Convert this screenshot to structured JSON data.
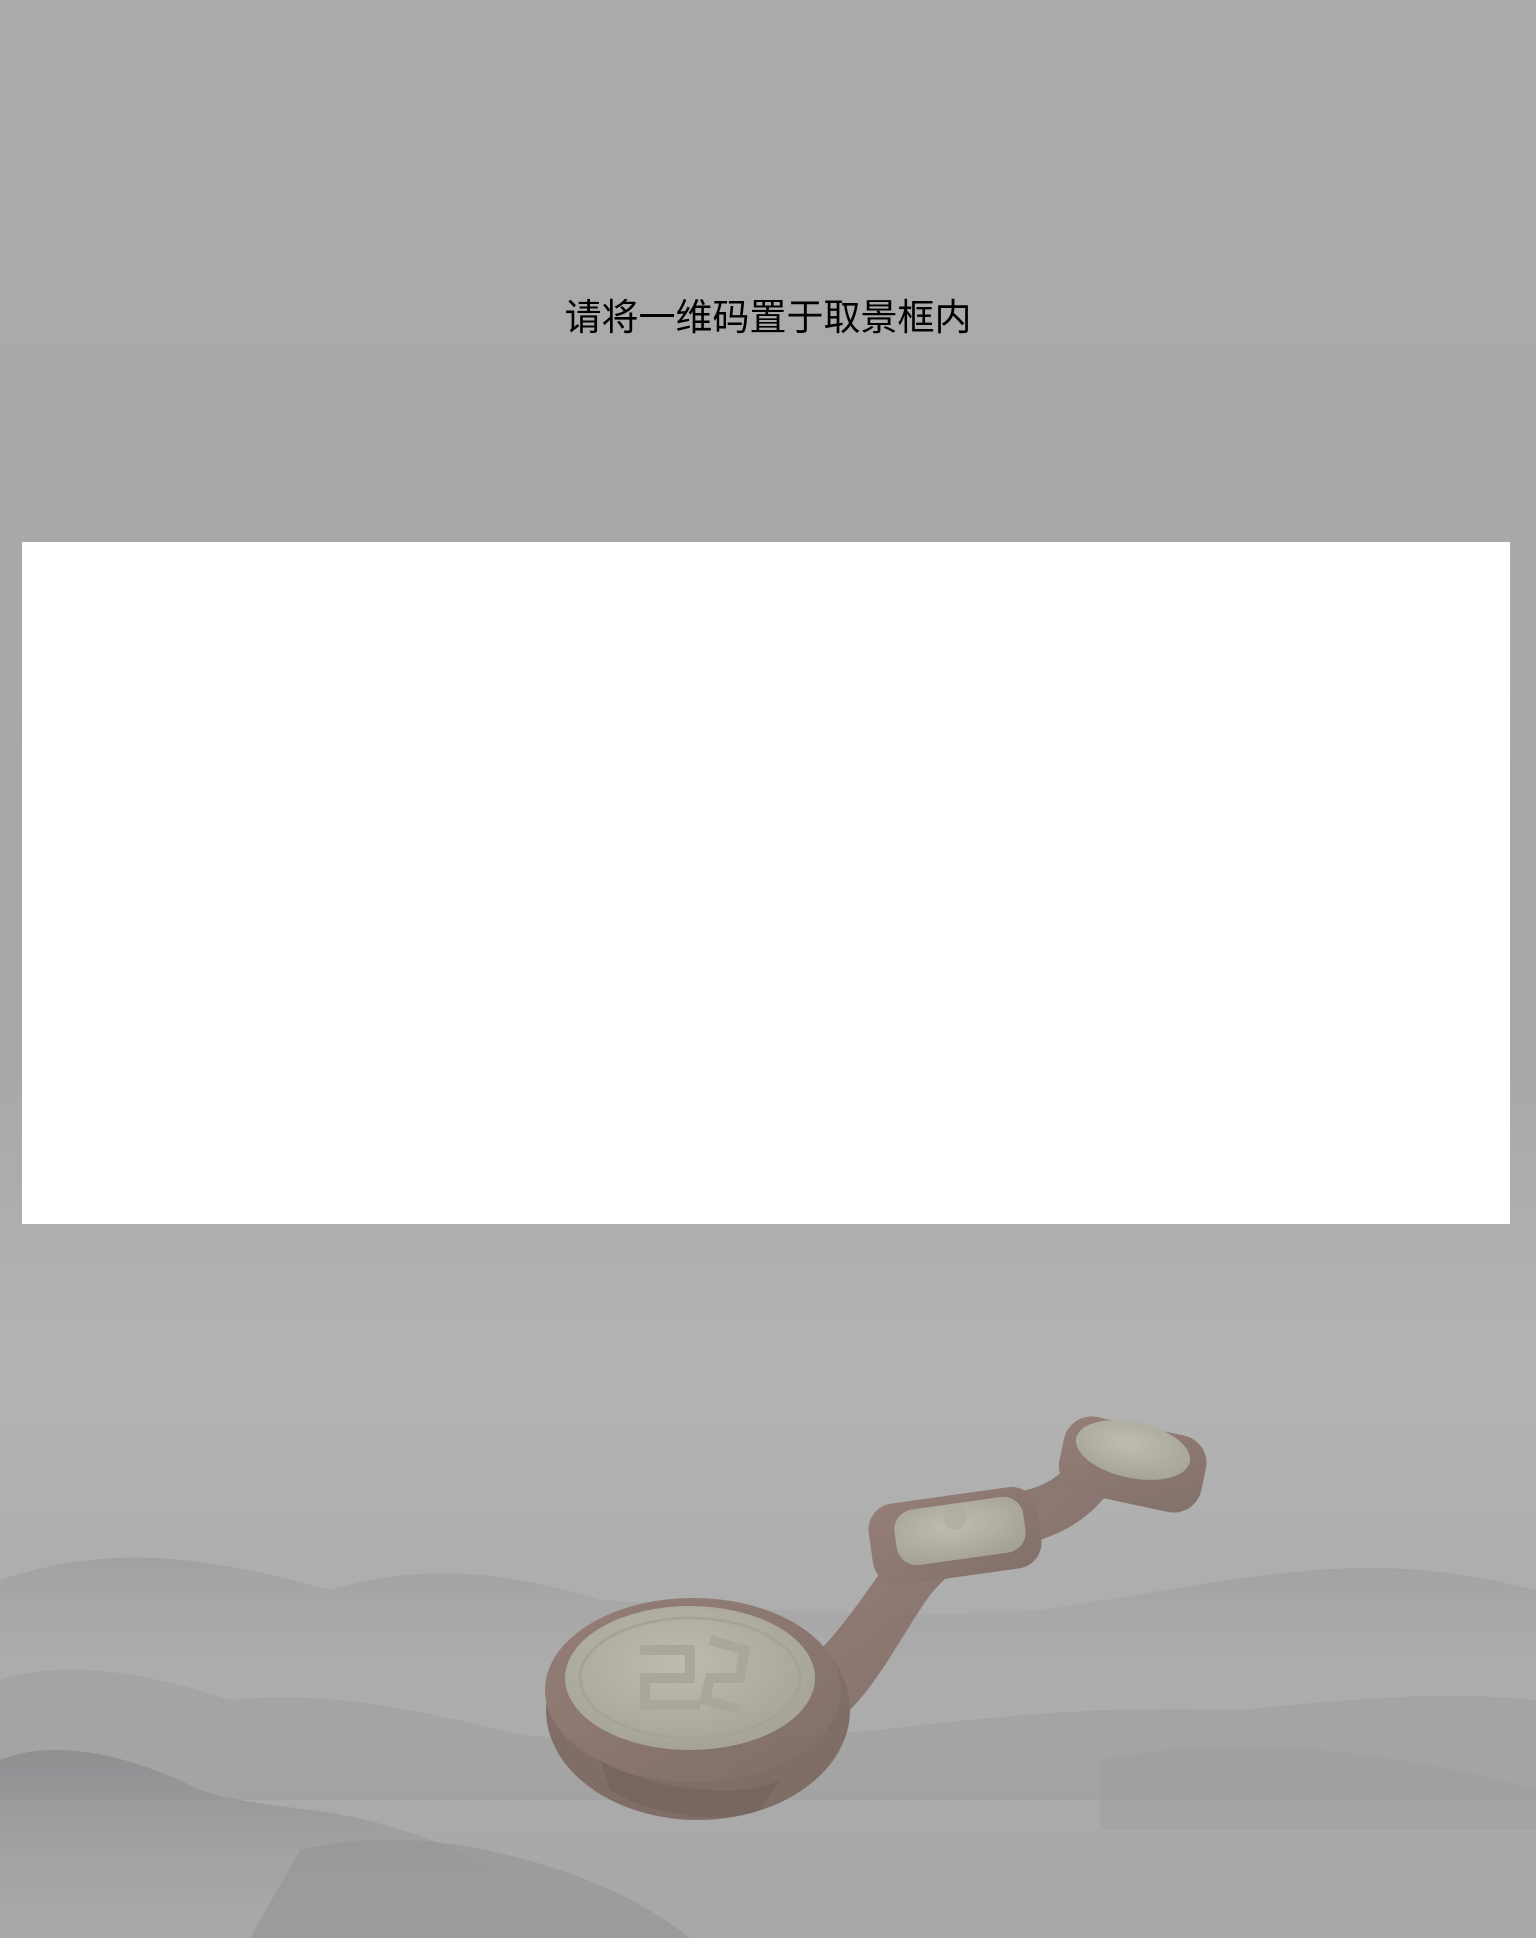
{
  "scanner": {
    "instruction": "请将一维码置于取景框内"
  },
  "colors": {
    "overlay": "#a9a9a9",
    "viewfinder": "#ffffff",
    "text": "#000000"
  },
  "background": {
    "image": "misty-ink-mountains-with-ruyi-scepter"
  }
}
